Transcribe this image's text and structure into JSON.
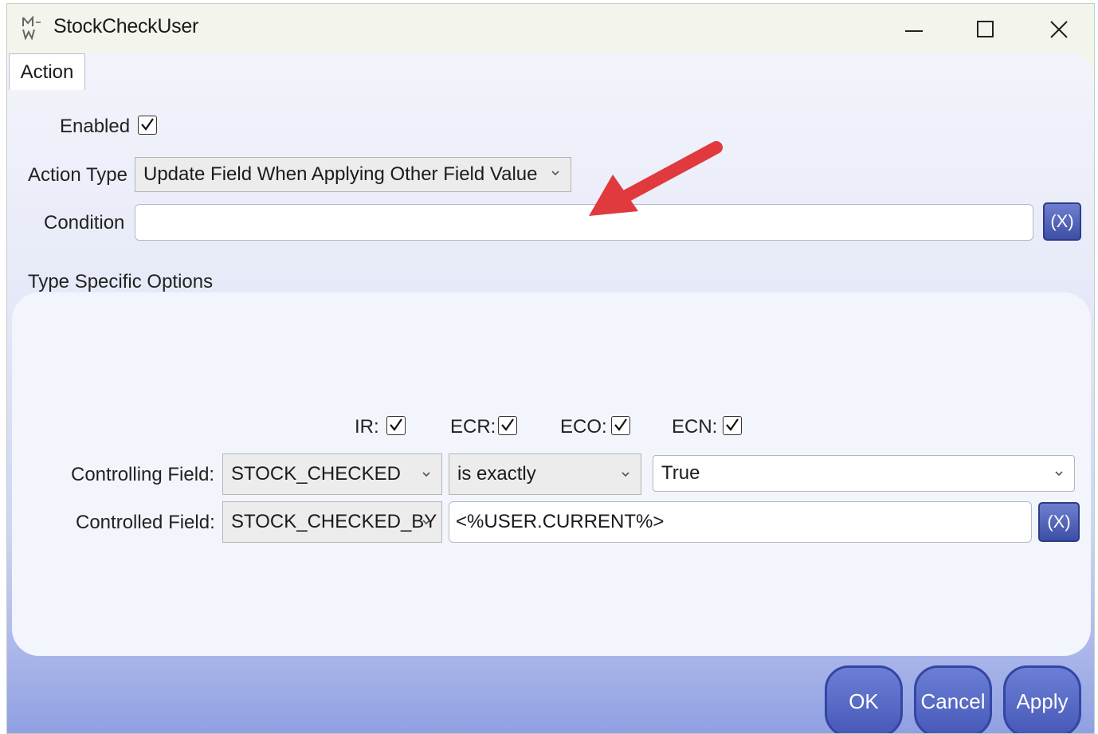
{
  "window": {
    "title": "StockCheckUser",
    "minimize_glyph": "minimize-icon",
    "maximize_glyph": "maximize-icon",
    "close_glyph": "close-icon"
  },
  "tabs": [
    {
      "label": "Action"
    }
  ],
  "form": {
    "enabled_label": "Enabled",
    "enabled_checked": true,
    "action_type_label": "Action Type",
    "action_type_value": "Update Field When Applying Other Field Value",
    "condition_label": "Condition",
    "condition_value": "",
    "condition_button": "(X)"
  },
  "type_specific": {
    "header": "Type Specific Options",
    "checkboxes": [
      {
        "label": "IR:",
        "checked": true
      },
      {
        "label": "ECR:",
        "checked": true
      },
      {
        "label": "ECO:",
        "checked": true
      },
      {
        "label": "ECN:",
        "checked": true
      }
    ],
    "controlling_field_label": "Controlling Field:",
    "controlling_field_value": "STOCK_CHECKED",
    "operator_value": "is exactly",
    "compare_value": "True",
    "controlled_field_label": "Controlled Field:",
    "controlled_field_value": "STOCK_CHECKED_BY",
    "controlled_value": "<%USER.CURRENT%>",
    "controlled_button": "(X)"
  },
  "buttons": {
    "ok": "OK",
    "cancel": "Cancel",
    "apply": "Apply"
  },
  "colors": {
    "accent": "#4659b8",
    "annotation_arrow": "#e0393e"
  }
}
